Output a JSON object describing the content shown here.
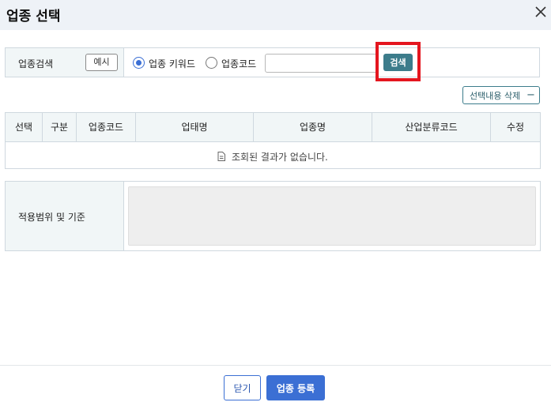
{
  "dialog": {
    "title": "업종 선택"
  },
  "search": {
    "label": "업종검색",
    "example_button": "예시",
    "radio_keyword": "업종 키워드",
    "radio_code": "업종코드",
    "input_value": "",
    "search_button": "검색",
    "selected_option": "업종 키워드"
  },
  "actions": {
    "delete_selected": "선택내용 삭제",
    "delete_icon": "minus-icon"
  },
  "table": {
    "columns": [
      "선택",
      "구분",
      "업종코드",
      "업태명",
      "업종명",
      "산업분류코드",
      "수정"
    ],
    "empty_message": "조회된 결과가 없습니다."
  },
  "scope": {
    "label": "적용범위 및 기준"
  },
  "footer": {
    "close_button": "닫기",
    "register_button": "업종 등록"
  },
  "colors": {
    "header_bg": "#eef2f7",
    "teal": "#3c7c8b",
    "primary_blue": "#3b6fd4",
    "highlight_red": "#e4161f"
  }
}
